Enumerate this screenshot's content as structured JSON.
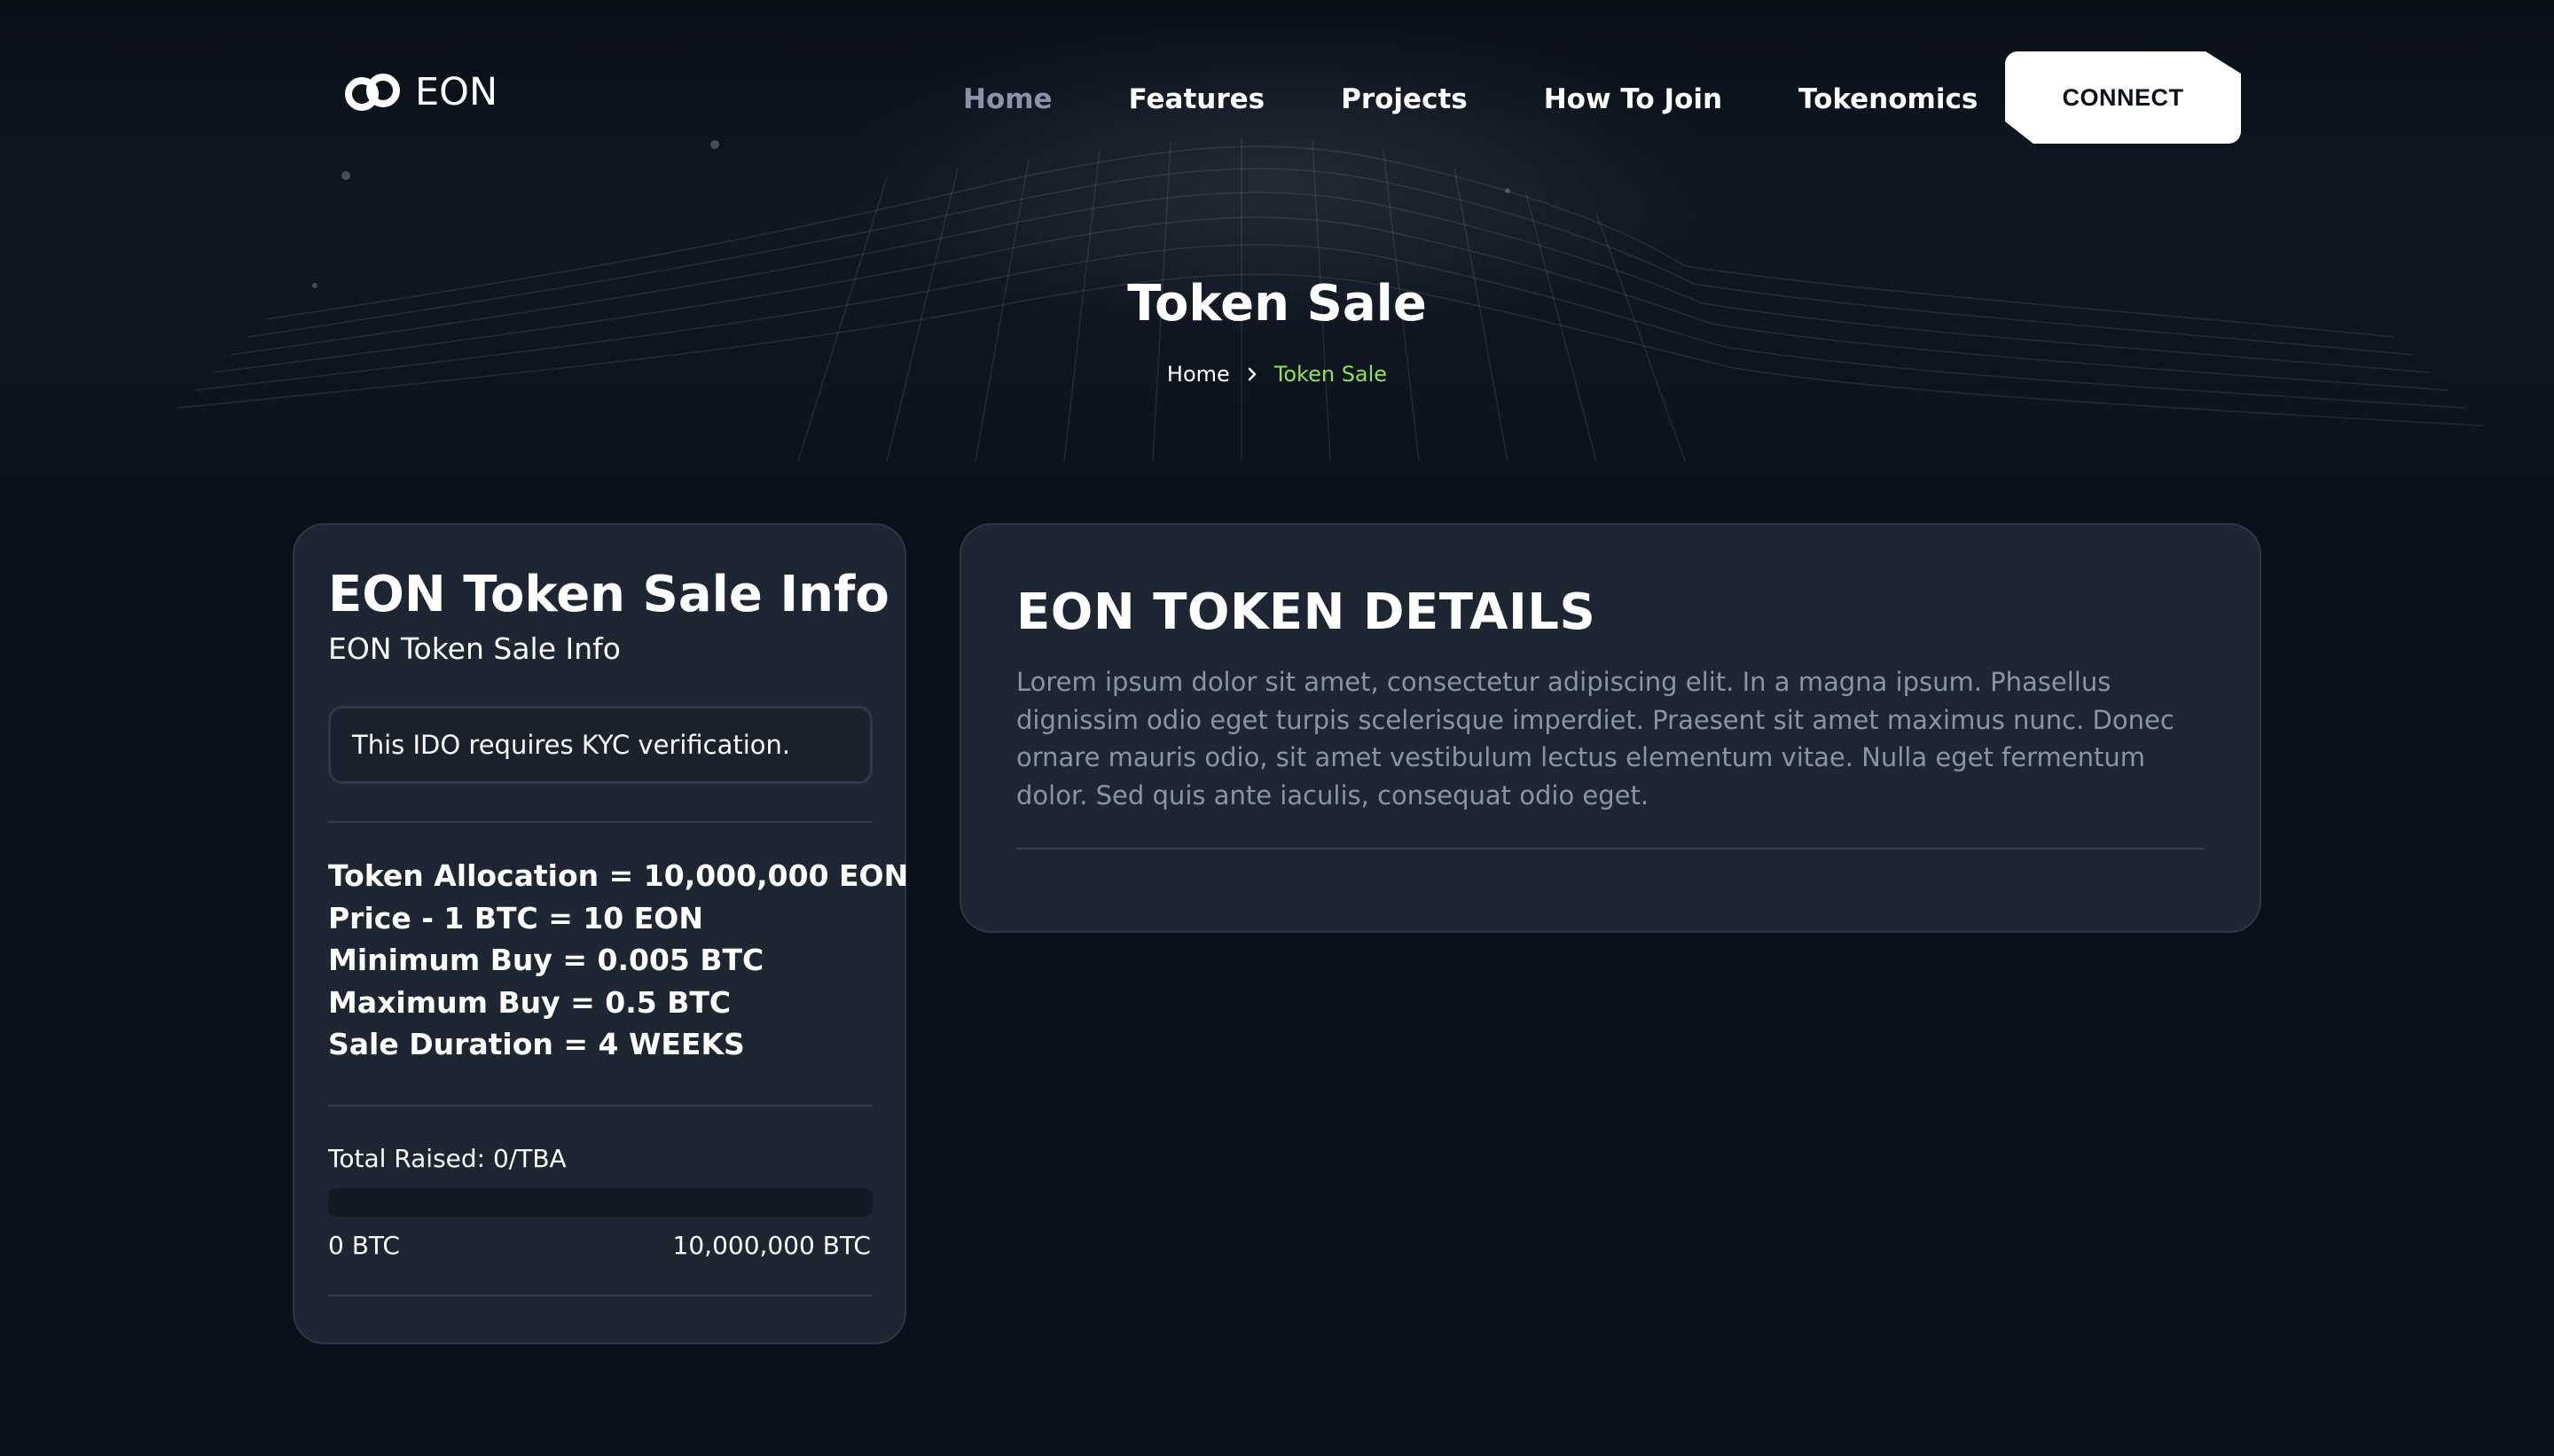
{
  "brand": {
    "name": "EON",
    "logo_icon": "infinity-rings-icon"
  },
  "nav": {
    "items": [
      {
        "label": "Home",
        "active": true
      },
      {
        "label": "Features",
        "active": false
      },
      {
        "label": "Projects",
        "active": false
      },
      {
        "label": "How To Join",
        "active": false
      },
      {
        "label": "Tokenomics",
        "active": false
      }
    ],
    "connect_label": "CONNECT"
  },
  "hero": {
    "title": "Token Sale",
    "breadcrumb": {
      "home": "Home",
      "separator_icon": "chevron-right-icon",
      "current": "Token Sale"
    }
  },
  "sale_info": {
    "title": "EON Token Sale Info",
    "subtitle": "EON Token Sale Info",
    "kyc_notice": "This IDO requires KYC verification.",
    "details": [
      "Token Allocation = 10,000,000 EON",
      "Price - 1 BTC = 10 EON",
      "Minimum Buy = 0.005 BTC",
      "Maximum Buy = 0.5 BTC",
      "Sale Duration = 4 WEEKS"
    ],
    "total_raised": "Total Raised: 0/TBA",
    "progress_fraction": 0,
    "range_min": "0 BTC",
    "range_max": "10,000,000 BTC"
  },
  "token_details": {
    "title": "EON TOKEN DETAILS",
    "body": "Lorem ipsum dolor sit amet, consectetur adipiscing elit. In a magna ipsum. Phasellus dignissim odio eget turpis scelerisque imperdiet. Praesent sit amet maximus nunc. Donec ornare mauris odio, sit amet vestibulum lectus elementum vitae. Nulla eget fermentum dolor. Sed quis ante iaculis, consequat odio eget."
  },
  "colors": {
    "background": "#0b111b",
    "card": "#1f2633",
    "accent_green": "#8fe35a",
    "muted_text": "#8a94a6"
  }
}
